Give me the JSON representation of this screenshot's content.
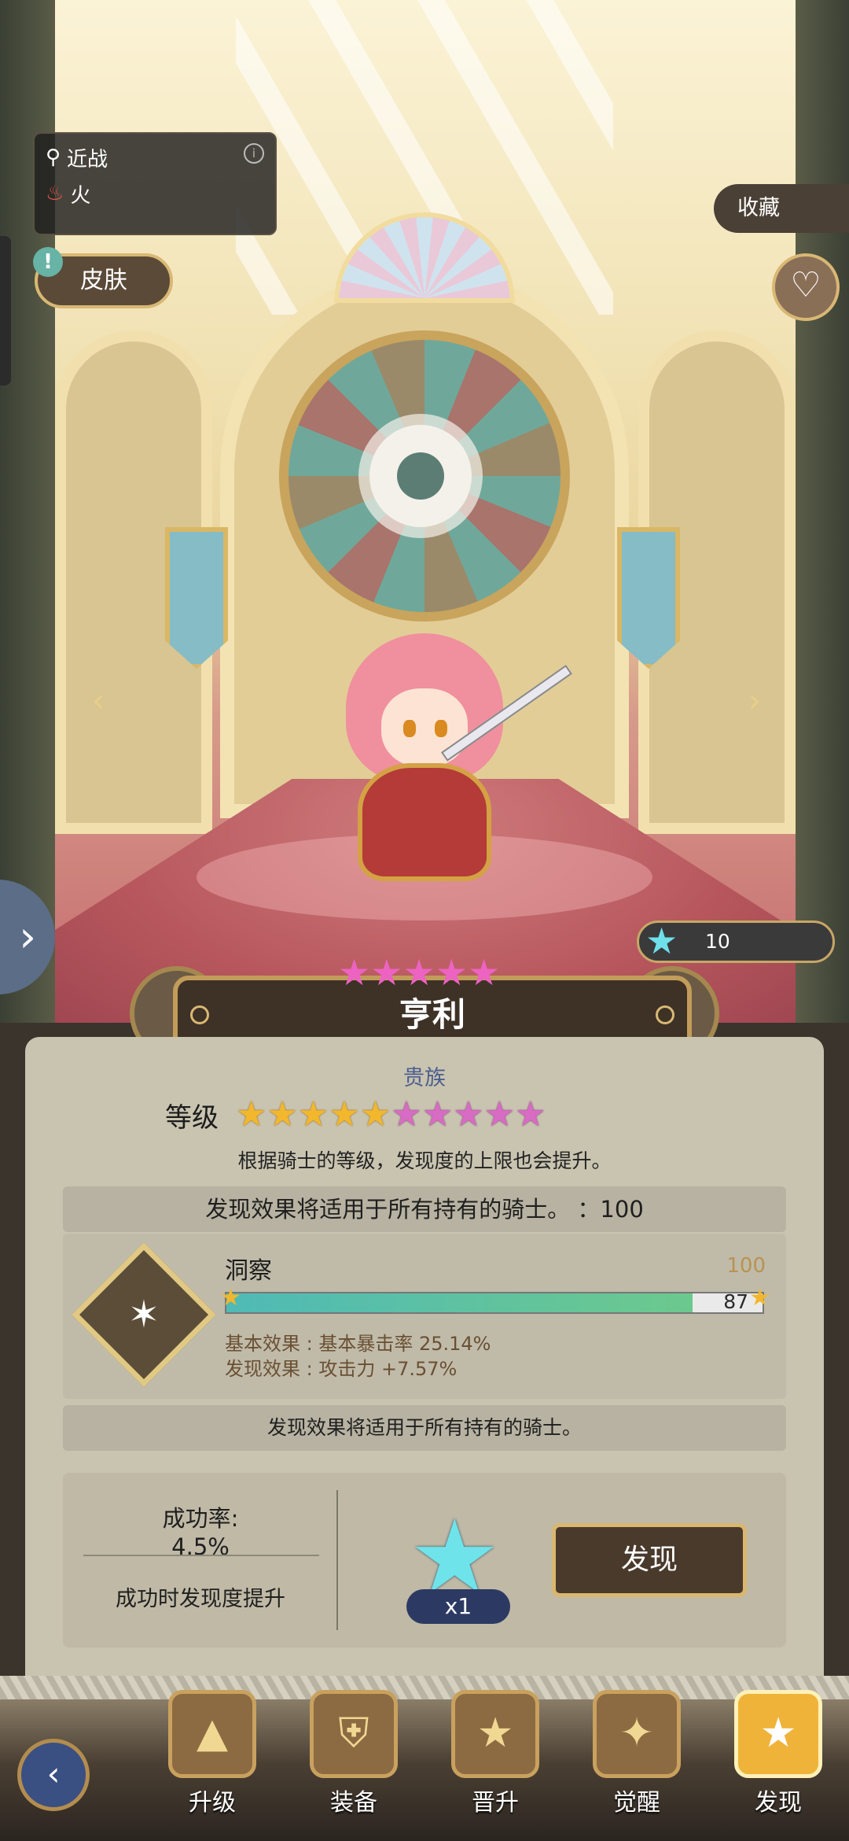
{
  "hero": {
    "attack_type": "近战",
    "element": "火",
    "name": "亨利",
    "title": "贵族",
    "crystal_count": "10"
  },
  "top_controls": {
    "skin_label": "皮肤",
    "collect_label": "收藏",
    "alert_mark": "!"
  },
  "level": {
    "label": "等级",
    "gold_stars": 5,
    "pink_stars": 5,
    "description": "根据骑士的等级，发现度的上限也会提升。"
  },
  "discovery": {
    "header": "发现效果将适用于所有持有的骑士。 ：100",
    "skill_name": "洞察",
    "max_value": "100",
    "current_value": "87",
    "progress_percent": 87,
    "base_effect": "基本效果 : 基本暴击率 25.14%",
    "discovery_effect": "发现效果 : 攻击力 +7.57%",
    "note": "发现效果将适用于所有持有的骑士。"
  },
  "attempt": {
    "rate_label": "成功率:",
    "rate_value": "4.5%",
    "rate_desc": "成功时发现度提升",
    "cost_count": "x1",
    "button_label": "发现"
  },
  "bottom_nav": {
    "items": [
      {
        "label": "升级",
        "icon": "upgrade-icon"
      },
      {
        "label": "装备",
        "icon": "equipment-icon"
      },
      {
        "label": "晋升",
        "icon": "promote-icon"
      },
      {
        "label": "觉醒",
        "icon": "awaken-icon"
      },
      {
        "label": "发现",
        "icon": "discover-icon",
        "active": true
      }
    ]
  },
  "colors": {
    "accent_gold": "#d9b770",
    "crystal": "#6fe3ea",
    "pink_star": "#d86bc3"
  }
}
